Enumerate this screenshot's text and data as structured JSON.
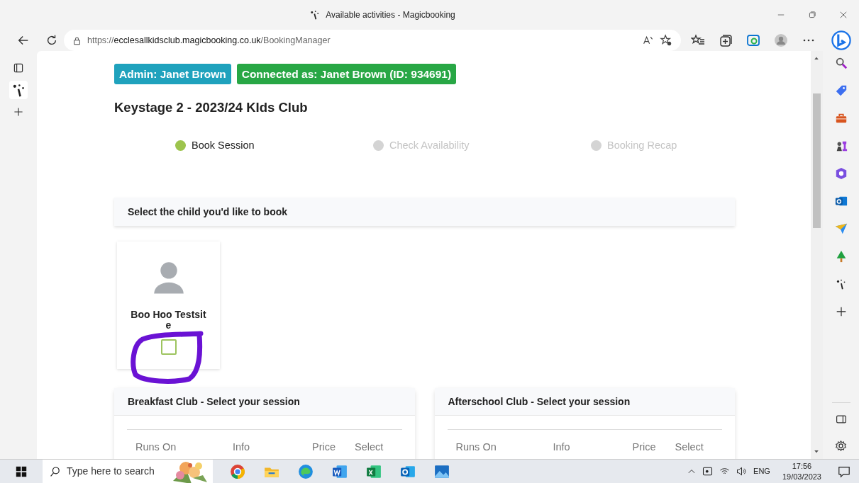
{
  "window": {
    "title": "Available activities - Magicbooking"
  },
  "address_bar": {
    "scheme": "https://",
    "host": "ecclesallkidsclub.magicbooking.co.uk",
    "path": "/BookingManager"
  },
  "badges": [
    {
      "text": "Admin: Janet Brown",
      "color": "#1fa2bd"
    },
    {
      "text": "Connected as: Janet Brown (ID: 934691)",
      "color": "#28a745"
    }
  ],
  "heading": "Keystage 2 - 2023/24 KIds Club",
  "steps": [
    {
      "label": "Book Session",
      "selected": true
    },
    {
      "label": "Check Availability",
      "selected": false
    },
    {
      "label": "Booking Recap",
      "selected": false
    }
  ],
  "child_prompt": "Select the child you'd like to book",
  "children": [
    {
      "name": "Boo Hoo Testsite",
      "checked": false
    }
  ],
  "panels": [
    {
      "title": "Breakfast Club - Select your session",
      "columns": [
        "Runs On",
        "Info",
        "Price",
        "Select"
      ]
    },
    {
      "title": "Afterschool Club - Select your session",
      "columns": [
        "Runs On",
        "Info",
        "Price",
        "Select"
      ]
    }
  ],
  "taskbar": {
    "search_placeholder": "Type here to search",
    "language": "ENG",
    "time": "17:56",
    "date": "19/03/2023"
  }
}
